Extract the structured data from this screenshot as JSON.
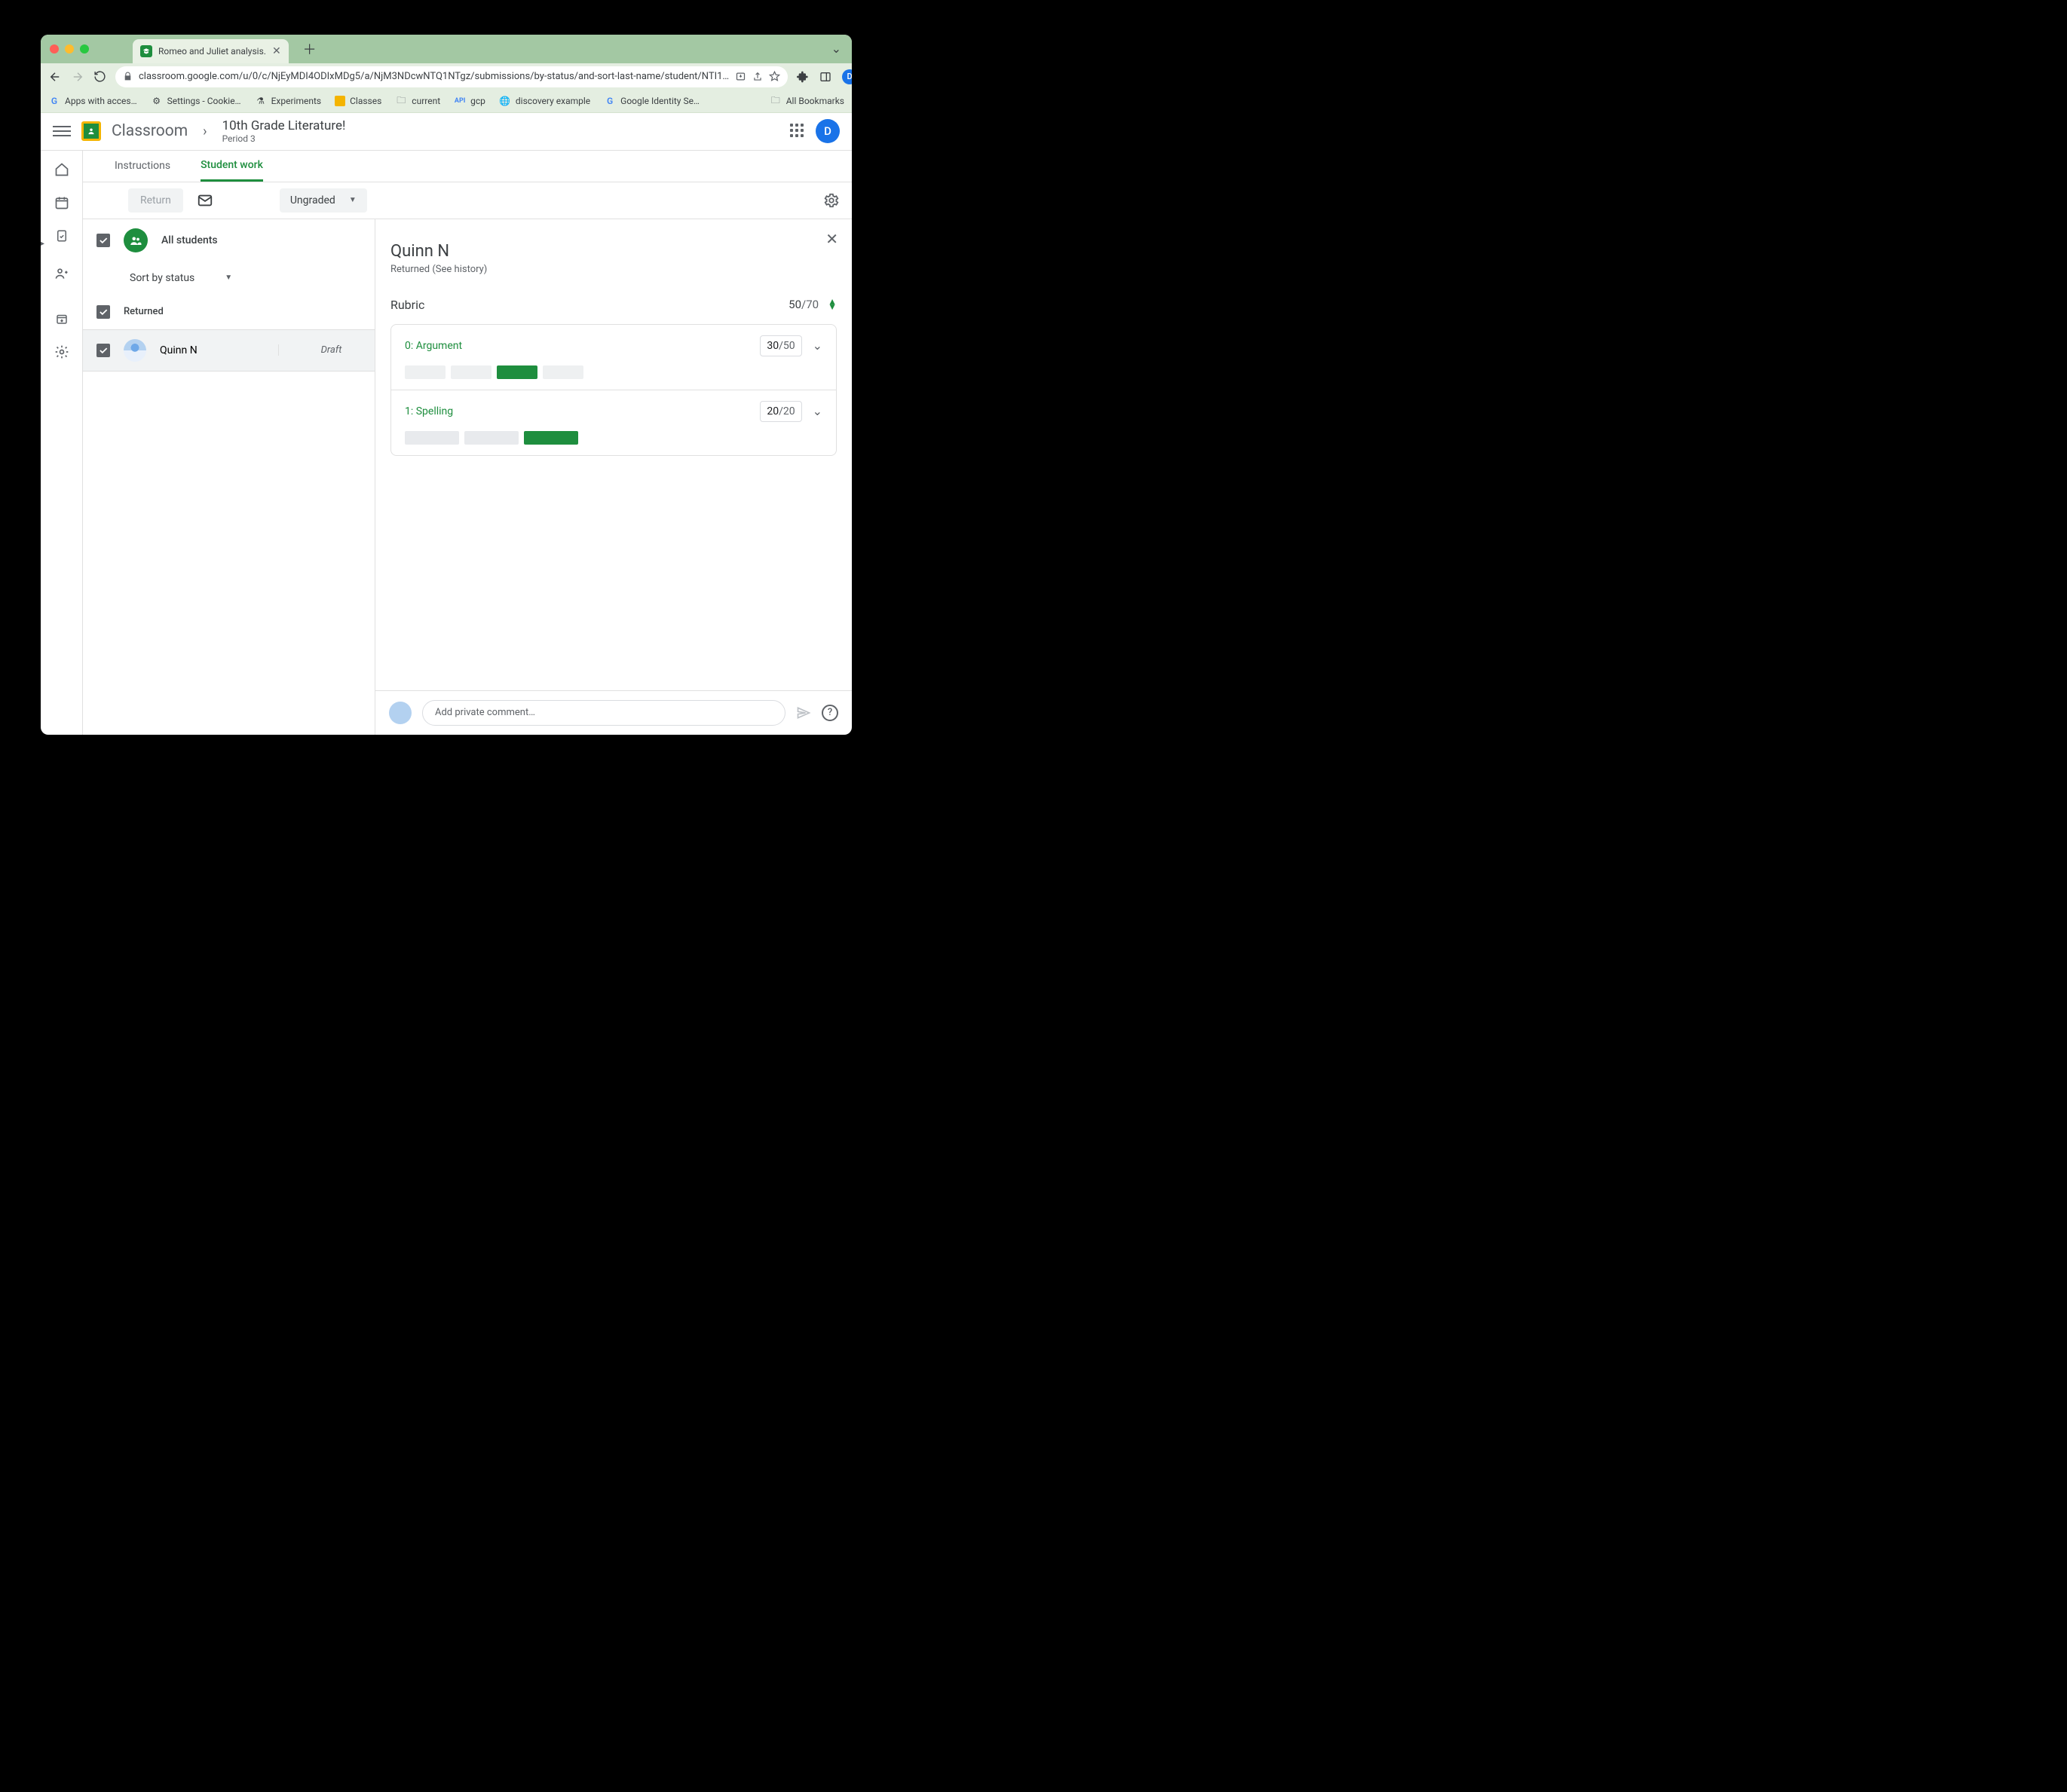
{
  "browser": {
    "tab_title": "Romeo and Juliet analysis.",
    "url": "classroom.google.com/u/0/c/NjEyMDI4ODIxMDg5/a/NjM3NDcwNTQ1NTgz/submissions/by-status/and-sort-last-name/student/NTI1…",
    "bookmarks": [
      "Apps with acces…",
      "Settings - Cookie…",
      "Experiments",
      "Classes",
      "current",
      "gcp",
      "discovery example",
      "Google Identity Se…"
    ],
    "all_bookmarks": "All Bookmarks",
    "avatar_letter": "D"
  },
  "header": {
    "product": "Classroom",
    "class_name": "10th Grade Literature!",
    "class_sub": "Period 3",
    "avatar_letter": "D"
  },
  "subtabs": {
    "instructions": "Instructions",
    "student_work": "Student work"
  },
  "toolbar": {
    "return": "Return",
    "filter": "Ungraded"
  },
  "left": {
    "all_students": "All students",
    "sort": "Sort by status",
    "section": "Returned",
    "student": {
      "name": "Quinn N",
      "status": "Draft"
    }
  },
  "detail": {
    "name": "Quinn N",
    "status": "Returned (See history)",
    "rubric_label": "Rubric",
    "score_num": "50",
    "score_den": "/70",
    "criteria": [
      {
        "name": "0: Argument",
        "pts": "30",
        "of": "/50",
        "levels": 4,
        "selected": 2
      },
      {
        "name": "1: Spelling",
        "pts": "20",
        "of": "/20",
        "levels": 3,
        "selected": 2
      }
    ]
  },
  "comment": {
    "placeholder": "Add private comment…"
  }
}
